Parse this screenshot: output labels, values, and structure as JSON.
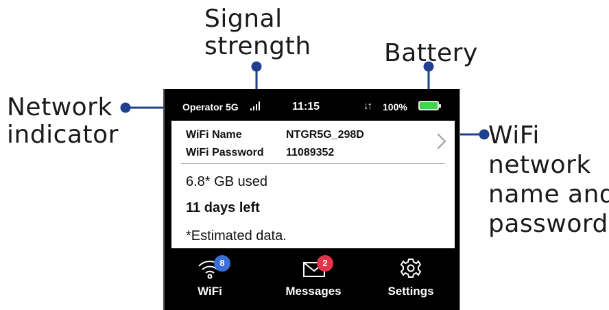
{
  "callouts": {
    "signal_line1": "Signal",
    "signal_line2": "strength",
    "battery": "Battery",
    "network_line1": "Network",
    "network_line2": "indicator",
    "wifi_line1": "WiFi",
    "wifi_line2": "network",
    "wifi_line3": "name and",
    "wifi_line4": "password"
  },
  "status_bar": {
    "operator": "Operator 5G",
    "time": "11:15",
    "transfer_arrows": "↓↑",
    "battery_percent": "100%",
    "battery_color": "#44d24a"
  },
  "wifi": {
    "name_label": "WiFi Name",
    "name_value": "NTGR5G_298D",
    "password_label": "WiFi Password",
    "password_value": "11089352"
  },
  "usage": {
    "used": "6.8* GB used",
    "days_left": "11 days left",
    "note": "*Estimated data."
  },
  "nav": {
    "wifi_label": "WiFi",
    "wifi_badge": "8",
    "wifi_badge_color": "#3b6fd8",
    "messages_label": "Messages",
    "messages_badge": "2",
    "messages_badge_color": "#e8344a",
    "settings_label": "Settings"
  },
  "colors": {
    "callout_line": "#1f3f8f"
  }
}
